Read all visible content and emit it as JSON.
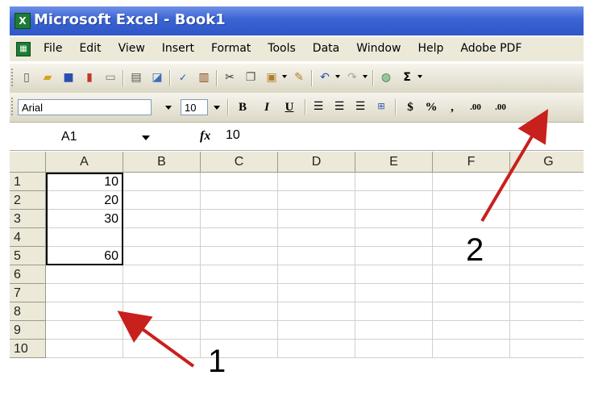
{
  "app": {
    "title": "Microsoft Excel - Book1",
    "excel_icon": "X"
  },
  "menu": {
    "doc_icon": "excel-doc-icon",
    "items": [
      "File",
      "Edit",
      "View",
      "Insert",
      "Format",
      "Tools",
      "Data",
      "Window",
      "Help",
      "Adobe PDF"
    ]
  },
  "standard_toolbar": {
    "buttons": [
      {
        "name": "new-icon",
        "glyph": "🗋"
      },
      {
        "name": "open-icon",
        "glyph": "📂"
      },
      {
        "name": "save-icon",
        "glyph": "💾"
      },
      {
        "name": "permission-icon",
        "glyph": "🔒"
      },
      {
        "name": "email-icon",
        "glyph": "📧"
      },
      {
        "name": "print-icon",
        "glyph": "🖶"
      },
      {
        "name": "print-preview-icon",
        "glyph": "🔍"
      },
      {
        "name": "spelling-icon",
        "glyph": "✓"
      },
      {
        "name": "research-icon",
        "glyph": "📖"
      },
      {
        "name": "cut-icon",
        "glyph": "✂"
      },
      {
        "name": "copy-icon",
        "glyph": "⎘"
      },
      {
        "name": "paste-icon",
        "glyph": "📋"
      },
      {
        "name": "format-painter-icon",
        "glyph": "🖌"
      },
      {
        "name": "undo-icon",
        "glyph": "↶"
      },
      {
        "name": "redo-icon",
        "glyph": "↷"
      },
      {
        "name": "hyperlink-icon",
        "glyph": "🌐"
      },
      {
        "name": "autosum-icon",
        "glyph": "Σ"
      }
    ]
  },
  "formatting_toolbar": {
    "font": "Arial",
    "size": "10",
    "bold": "B",
    "italic": "I",
    "underline": "U",
    "currency": "$",
    "percent": "%",
    "comma": ",",
    "increase_decimal": ".00"
  },
  "formula_bar": {
    "name_box": "A1",
    "fx": "fx",
    "value": "10"
  },
  "sheet": {
    "columns": [
      "A",
      "B",
      "C",
      "D",
      "E",
      "F",
      "G"
    ],
    "rows": [
      "1",
      "2",
      "3",
      "4",
      "5",
      "6",
      "7",
      "8",
      "9",
      "10"
    ],
    "column_a_values": [
      "10",
      "20",
      "30",
      "",
      "60",
      "",
      "",
      "",
      "",
      ""
    ],
    "selected_range": "A1:A5"
  },
  "annotations": {
    "label_1": "1",
    "label_2": "2",
    "arrow_color": "#c8201c"
  }
}
